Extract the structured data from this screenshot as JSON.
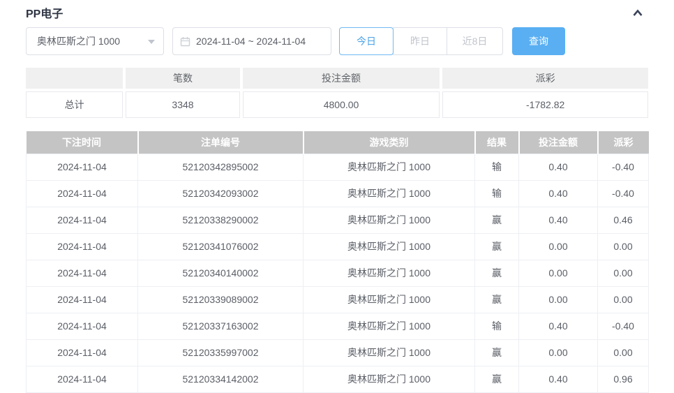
{
  "panel": {
    "title": "PP电子"
  },
  "filters": {
    "game_select": {
      "value": "奥林匹斯之门 1000"
    },
    "date_range": {
      "value": "2024-11-04 ~ 2024-11-04"
    },
    "quick_buttons": [
      {
        "label": "今日",
        "active": true
      },
      {
        "label": "昨日",
        "active": false
      },
      {
        "label": "近8日",
        "active": false
      }
    ],
    "search_label": "查询"
  },
  "summary": {
    "headers": [
      "",
      "笔数",
      "投注金额",
      "派彩"
    ],
    "row_label": "总计",
    "count": "3348",
    "bet_amount": "4800.00",
    "payout": "-1782.82"
  },
  "detail": {
    "headers": [
      "下注时间",
      "注单编号",
      "游戏类别",
      "结果",
      "投注金额",
      "派彩"
    ],
    "rows": [
      {
        "date": "2024-11-04",
        "id": "52120342895002",
        "game": "奥林匹斯之门 1000",
        "result": "输",
        "bet": "0.40",
        "payout": "-0.40"
      },
      {
        "date": "2024-11-04",
        "id": "52120342093002",
        "game": "奥林匹斯之门 1000",
        "result": "输",
        "bet": "0.40",
        "payout": "-0.40"
      },
      {
        "date": "2024-11-04",
        "id": "52120338290002",
        "game": "奥林匹斯之门 1000",
        "result": "赢",
        "bet": "0.40",
        "payout": "0.46"
      },
      {
        "date": "2024-11-04",
        "id": "52120341076002",
        "game": "奥林匹斯之门 1000",
        "result": "赢",
        "bet": "0.00",
        "payout": "0.00"
      },
      {
        "date": "2024-11-04",
        "id": "52120340140002",
        "game": "奥林匹斯之门 1000",
        "result": "赢",
        "bet": "0.00",
        "payout": "0.00"
      },
      {
        "date": "2024-11-04",
        "id": "52120339089002",
        "game": "奥林匹斯之门 1000",
        "result": "赢",
        "bet": "0.00",
        "payout": "0.00"
      },
      {
        "date": "2024-11-04",
        "id": "52120337163002",
        "game": "奥林匹斯之门 1000",
        "result": "输",
        "bet": "0.40",
        "payout": "-0.40"
      },
      {
        "date": "2024-11-04",
        "id": "52120335997002",
        "game": "奥林匹斯之门 1000",
        "result": "赢",
        "bet": "0.00",
        "payout": "0.00"
      },
      {
        "date": "2024-11-04",
        "id": "52120334142002",
        "game": "奥林匹斯之门 1000",
        "result": "赢",
        "bet": "0.40",
        "payout": "0.96"
      }
    ]
  },
  "colors": {
    "accent_blue": "#59aff2",
    "active_border_blue": "#70b9f3",
    "negative_red": "#f56c6c",
    "detail_header_gray": "#c4c4c4",
    "summary_header_gray": "#f0f0f0"
  }
}
